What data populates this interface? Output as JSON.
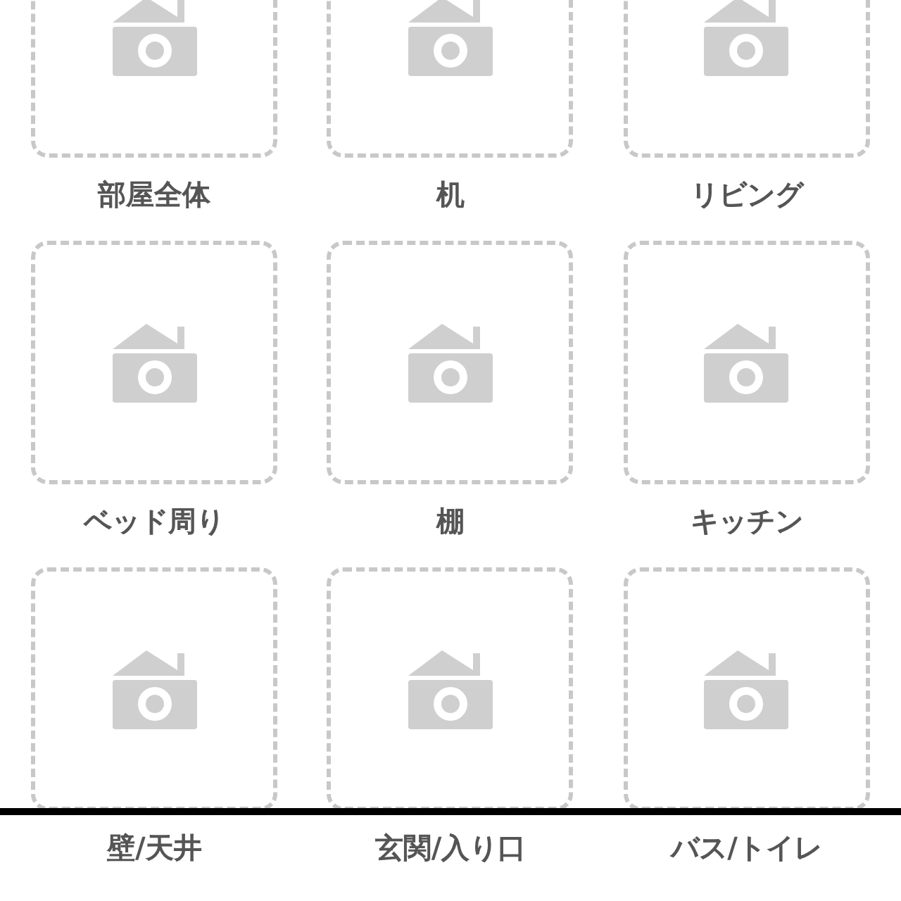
{
  "tiles": [
    {
      "label": "部屋全体"
    },
    {
      "label": "机"
    },
    {
      "label": "リビング"
    },
    {
      "label": "ベッド周り"
    },
    {
      "label": "棚"
    },
    {
      "label": "キッチン"
    },
    {
      "label": "壁/天井"
    },
    {
      "label": "玄関/入り口"
    },
    {
      "label": "バス/トイレ"
    }
  ]
}
